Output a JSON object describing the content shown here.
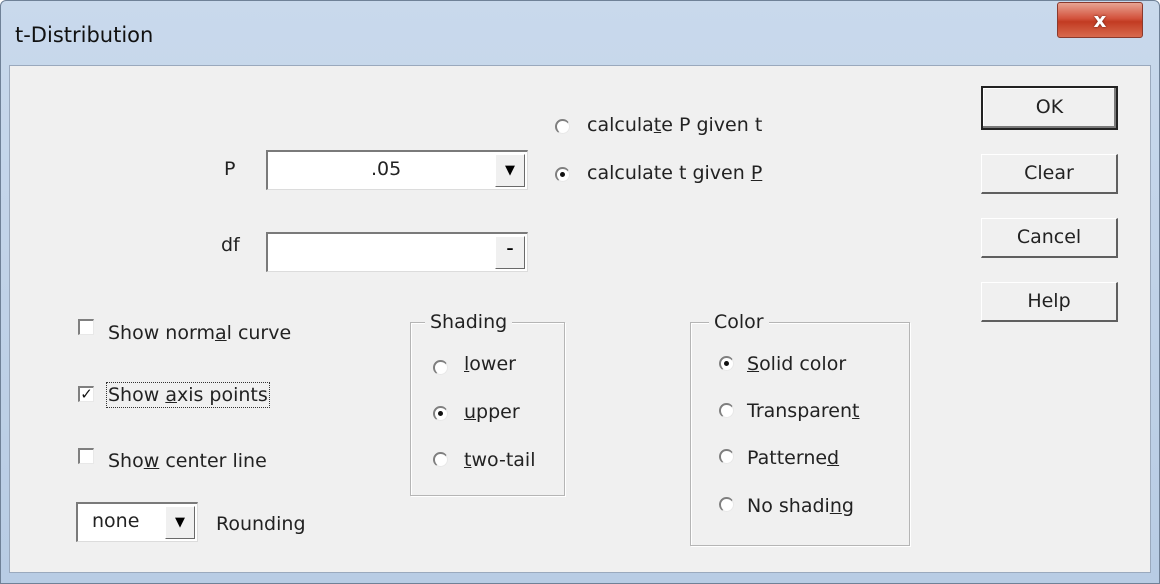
{
  "window": {
    "title": "t-Distribution",
    "close_glyph": "x"
  },
  "mode": {
    "option_p": "calculate P given t",
    "option_t": "calculate t given P",
    "selected": "calculate t given P"
  },
  "fields": {
    "p_label": "P",
    "p_value": ".05",
    "df_label": "df",
    "df_value": ""
  },
  "options": {
    "show_normal_curve": {
      "label": "Show normal curve",
      "checked": false
    },
    "show_axis_points": {
      "label": "Show axis points",
      "checked": true
    },
    "show_center_line": {
      "label": "Show center line",
      "checked": false
    }
  },
  "rounding": {
    "value": "none",
    "label": "Rounding"
  },
  "shading": {
    "title": "Shading",
    "lower": "lower",
    "upper": "upper",
    "two_tail": "two-tail",
    "selected": "upper"
  },
  "color": {
    "title": "Color",
    "solid": "Solid color",
    "transparent": "Transparent",
    "patterned": "Patterned",
    "no_shading": "No shading",
    "selected": "Solid color"
  },
  "buttons": {
    "ok": "OK",
    "clear": "Clear",
    "cancel": "Cancel",
    "help": "Help"
  },
  "icons": {
    "dropdown": "chevron-down-icon",
    "close": "close-icon",
    "check": "check-icon"
  },
  "colors": {
    "close_button": "#c23b22",
    "title_bar": "#c9d9ec",
    "client_bg": "#f0f0f0"
  }
}
